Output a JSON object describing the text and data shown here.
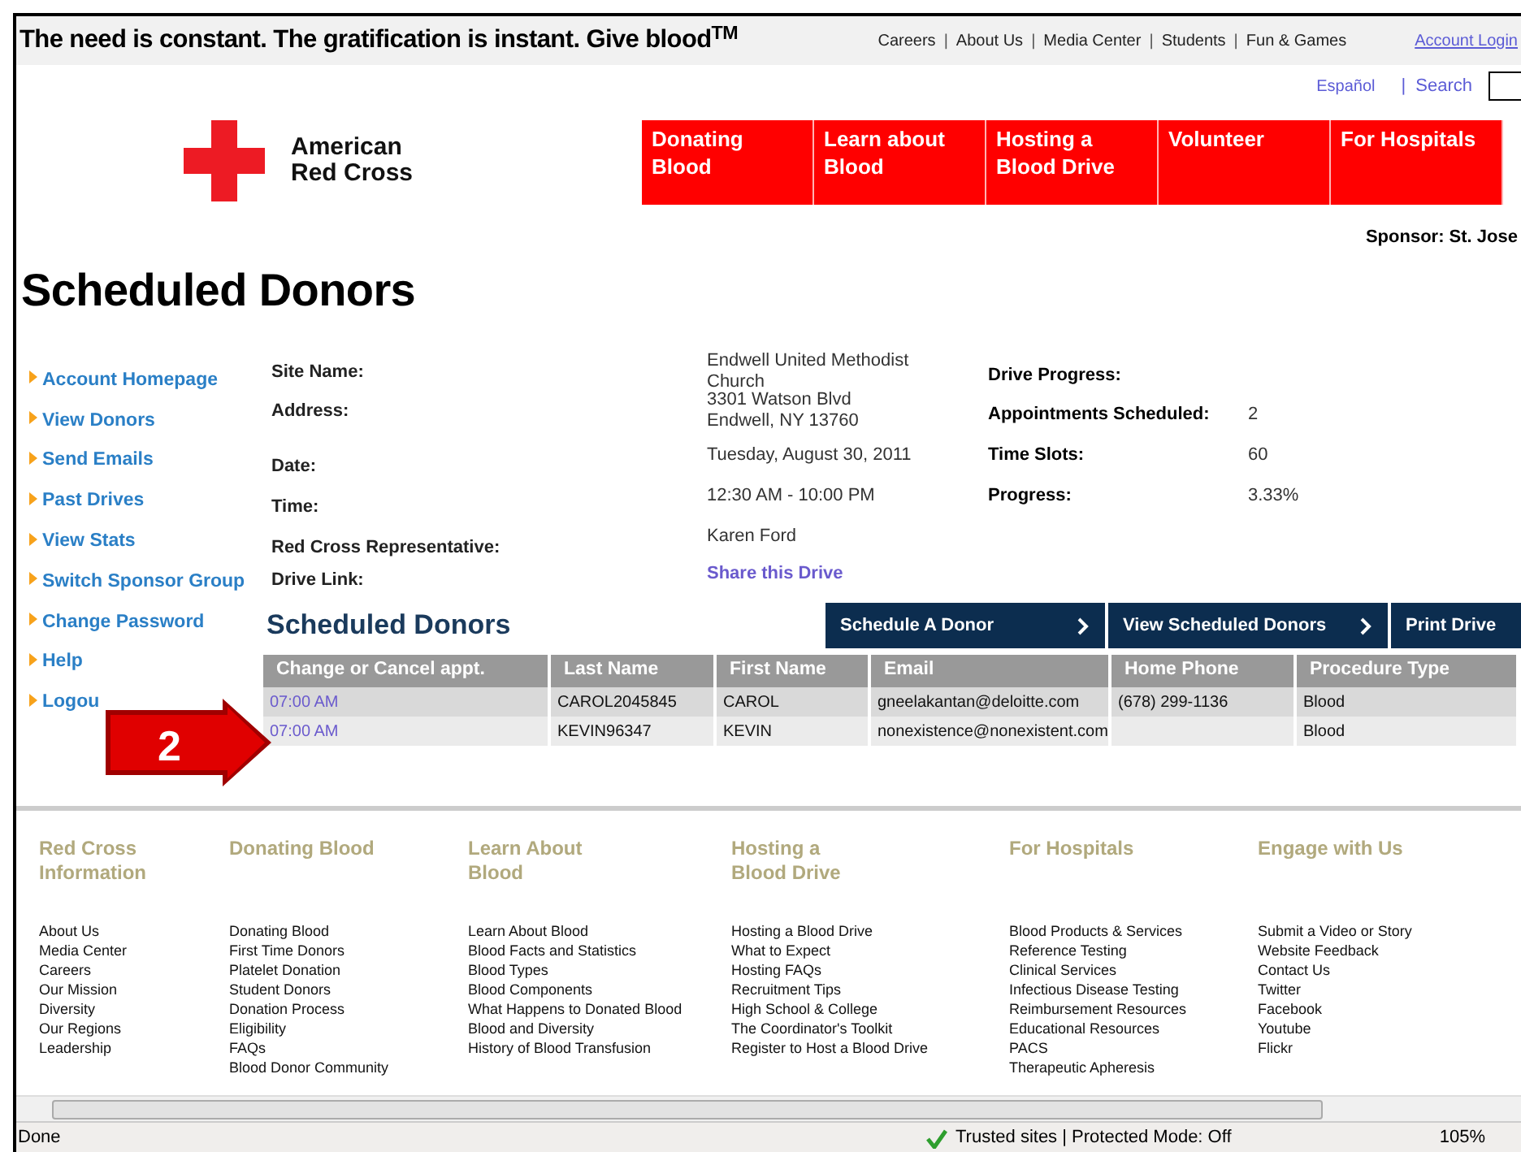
{
  "top_bar": {
    "tagline": "The need is constant. The gratification is instant. Give blood$^{TM}$",
    "links": [
      "Careers",
      "About Us",
      "Media Center",
      "Students",
      "Fun & Games"
    ],
    "separator": "|",
    "account_link": "Account Login"
  },
  "utility": {
    "language": "Español",
    "separator": "|",
    "search_label": "Search"
  },
  "logo": {
    "line1": "American",
    "line2": "Red Cross"
  },
  "nav": [
    "Donating Blood",
    "Learn about Blood",
    "Hosting a Blood Drive",
    "Volunteer",
    "For Hospitals"
  ],
  "sponsor": "Sponsor: St. Jose",
  "page_title": "Scheduled Donors",
  "sidebar": [
    "Account Homepage",
    "View Donors",
    "Send Emails",
    "Past Drives",
    "View Stats",
    "Switch Sponsor Group",
    "Change Password",
    "Help",
    "Logou"
  ],
  "drive_details": [
    {
      "label": "Site Name:",
      "value": "Endwell United Methodist Church",
      "kind": "text"
    },
    {
      "label": "Address:",
      "value": "3301 Watson Blvd\nEndwell, NY 13760",
      "kind": "text"
    },
    {
      "label": "Date:",
      "value": "Tuesday, August 30, 2011",
      "kind": "text"
    },
    {
      "label": "Time:",
      "value": "12:30 AM - 10:00 PM",
      "kind": "text"
    },
    {
      "label": "Red Cross Representative:",
      "value": "Karen Ford",
      "kind": "text"
    },
    {
      "label": "Drive Link:",
      "value": "Share this Drive",
      "kind": "link"
    }
  ],
  "drive_progress": {
    "heading": "Drive Progress:",
    "rows": [
      {
        "label": "Appointments Scheduled:",
        "value": "2"
      },
      {
        "label": "Time Slots:",
        "value": "60"
      },
      {
        "label": "Progress:",
        "value": "3.33%"
      }
    ]
  },
  "donors_section": {
    "title": "Scheduled Donors",
    "buttons": [
      {
        "label": "Schedule A Donor",
        "arrow": true
      },
      {
        "label": "View Scheduled Donors",
        "arrow": true
      },
      {
        "label": "Print Drive",
        "arrow": false
      }
    ],
    "columns": [
      "Change or Cancel appt.",
      "Last Name",
      "First Name",
      "Email",
      "Home Phone",
      "Procedure Type"
    ],
    "rows": [
      [
        "07:00 AM",
        "CAROL2045845",
        "CAROL",
        "gneelakantan@deloitte.com",
        "(678) 299-1136",
        "Blood"
      ],
      [
        "07:00 AM",
        "KEVIN96347",
        "KEVIN",
        "nonexistence@nonexistent.com",
        "",
        "Blood"
      ]
    ]
  },
  "callout": "2",
  "footer": [
    {
      "heading": "Red Cross Information",
      "links": [
        "About Us",
        "Media Center",
        "Careers",
        "Our Mission",
        "Diversity",
        "Our Regions",
        "Leadership"
      ]
    },
    {
      "heading": "Donating Blood",
      "links": [
        "Donating Blood",
        "First Time Donors",
        "Platelet Donation",
        "Student Donors",
        "Donation Process",
        "Eligibility",
        "FAQs",
        "Blood Donor Community"
      ]
    },
    {
      "heading": "Learn About Blood",
      "links": [
        "Learn About Blood",
        "Blood Facts and Statistics",
        "Blood Types",
        "Blood Components",
        "What Happens to Donated Blood",
        "Blood and Diversity",
        "History of Blood Transfusion"
      ]
    },
    {
      "heading": "Hosting a Blood Drive",
      "links": [
        "Hosting a Blood Drive",
        "What to Expect",
        "Hosting FAQs",
        "Recruitment Tips",
        "High School & College",
        "The Coordinator's Toolkit",
        "Register to Host a Blood Drive"
      ]
    },
    {
      "heading": "For Hospitals",
      "links": [
        "Blood Products & Services",
        "Reference Testing",
        "Clinical Services",
        "Infectious Disease Testing",
        "Reimbursement Resources",
        "Educational Resources",
        "PACS",
        "Therapeutic Apheresis"
      ]
    },
    {
      "heading": "Engage with Us",
      "links": [
        "Submit a Video or Story",
        "Website Feedback",
        "Contact Us",
        "Twitter",
        "Facebook",
        "Youtube",
        "Flickr"
      ]
    }
  ],
  "status_bar": {
    "status": "Done",
    "zone": "Trusted sites | Protected Mode: Off",
    "zoom": "105%"
  }
}
